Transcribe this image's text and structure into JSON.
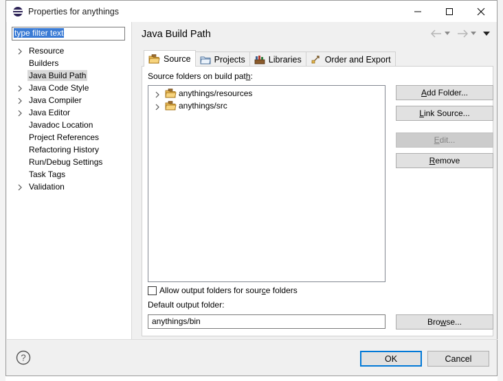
{
  "window": {
    "title": "Properties for anythings"
  },
  "filter": {
    "value": "type filter text"
  },
  "tree": [
    {
      "label": "Resource",
      "expandable": true,
      "selected": false
    },
    {
      "label": "Builders",
      "expandable": false,
      "selected": false
    },
    {
      "label": "Java Build Path",
      "expandable": false,
      "selected": true
    },
    {
      "label": "Java Code Style",
      "expandable": true,
      "selected": false
    },
    {
      "label": "Java Compiler",
      "expandable": true,
      "selected": false
    },
    {
      "label": "Java Editor",
      "expandable": true,
      "selected": false
    },
    {
      "label": "Javadoc Location",
      "expandable": false,
      "selected": false
    },
    {
      "label": "Project References",
      "expandable": false,
      "selected": false
    },
    {
      "label": "Refactoring History",
      "expandable": false,
      "selected": false
    },
    {
      "label": "Run/Debug Settings",
      "expandable": false,
      "selected": false
    },
    {
      "label": "Task Tags",
      "expandable": false,
      "selected": false
    },
    {
      "label": "Validation",
      "expandable": true,
      "selected": false
    }
  ],
  "page": {
    "title": "Java Build Path"
  },
  "tabs": [
    {
      "label": "Source",
      "icon": "source-folder-icon",
      "active": true
    },
    {
      "label": "Projects",
      "icon": "projects-icon",
      "active": false
    },
    {
      "label": "Libraries",
      "icon": "libraries-icon",
      "active": false
    },
    {
      "label": "Order and Export",
      "icon": "order-export-icon",
      "active": false
    }
  ],
  "source": {
    "folders_label_pre": "Source folders on build pat",
    "folders_label_u": "h",
    "folders_label_post": ":",
    "folders": [
      "anythings/resources",
      "anythings/src"
    ],
    "buttons": {
      "add_folder": {
        "pre": "",
        "u": "A",
        "post": "dd Folder..."
      },
      "link_source": {
        "pre": "",
        "u": "L",
        "post": "ink Source..."
      },
      "edit": {
        "pre": "",
        "u": "E",
        "post": "dit..."
      },
      "remove": {
        "pre": "",
        "u": "R",
        "post": "emove"
      },
      "browse": {
        "pre": "Bro",
        "u": "w",
        "post": "se..."
      }
    },
    "allow_output_pre": "Allow output folders for sour",
    "allow_output_u": "c",
    "allow_output_post": "e folders",
    "default_output_label": "Default output folder:",
    "default_output_value": "anythings/bin"
  },
  "footer": {
    "ok_label": "OK",
    "cancel_label": "Cancel"
  },
  "colors": {
    "accent": "#0078d7",
    "selection": "#3a7bd5",
    "tree_selected": "#d9d9d9",
    "folder": "#e8a33b"
  }
}
